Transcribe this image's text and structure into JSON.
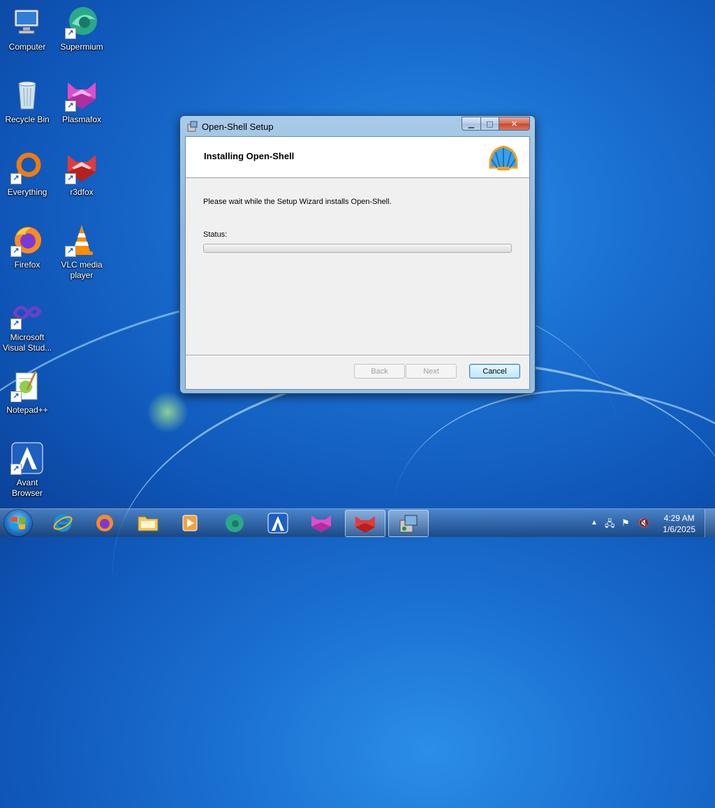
{
  "desktop": {
    "icons": [
      {
        "label": "Computer"
      },
      {
        "label": "Supermium"
      },
      {
        "label": "Recycle Bin"
      },
      {
        "label": "Plasmafox"
      },
      {
        "label": "Everything"
      },
      {
        "label": "r3dfox"
      },
      {
        "label": "Firefox"
      },
      {
        "label": "VLC media player"
      },
      {
        "label": "Microsoft Visual Stud..."
      },
      {
        "label": "Notepad++"
      },
      {
        "label": "Avant Browser"
      }
    ]
  },
  "window": {
    "title": "Open-Shell Setup",
    "banner_title": "Installing Open-Shell",
    "message": "Please wait while the Setup Wizard installs Open-Shell.",
    "status_label": "Status:",
    "progress_fraction": 0.0,
    "buttons": {
      "back": "Back",
      "next": "Next",
      "cancel": "Cancel"
    }
  },
  "taskbar": {
    "items": [
      "internet-explorer",
      "firefox",
      "file-explorer",
      "media-player",
      "supermium",
      "avant-browser",
      "plasmafox",
      "r3dfox",
      "open-shell-setup"
    ],
    "time": "4:29 AM",
    "date": "1/6/2025"
  }
}
